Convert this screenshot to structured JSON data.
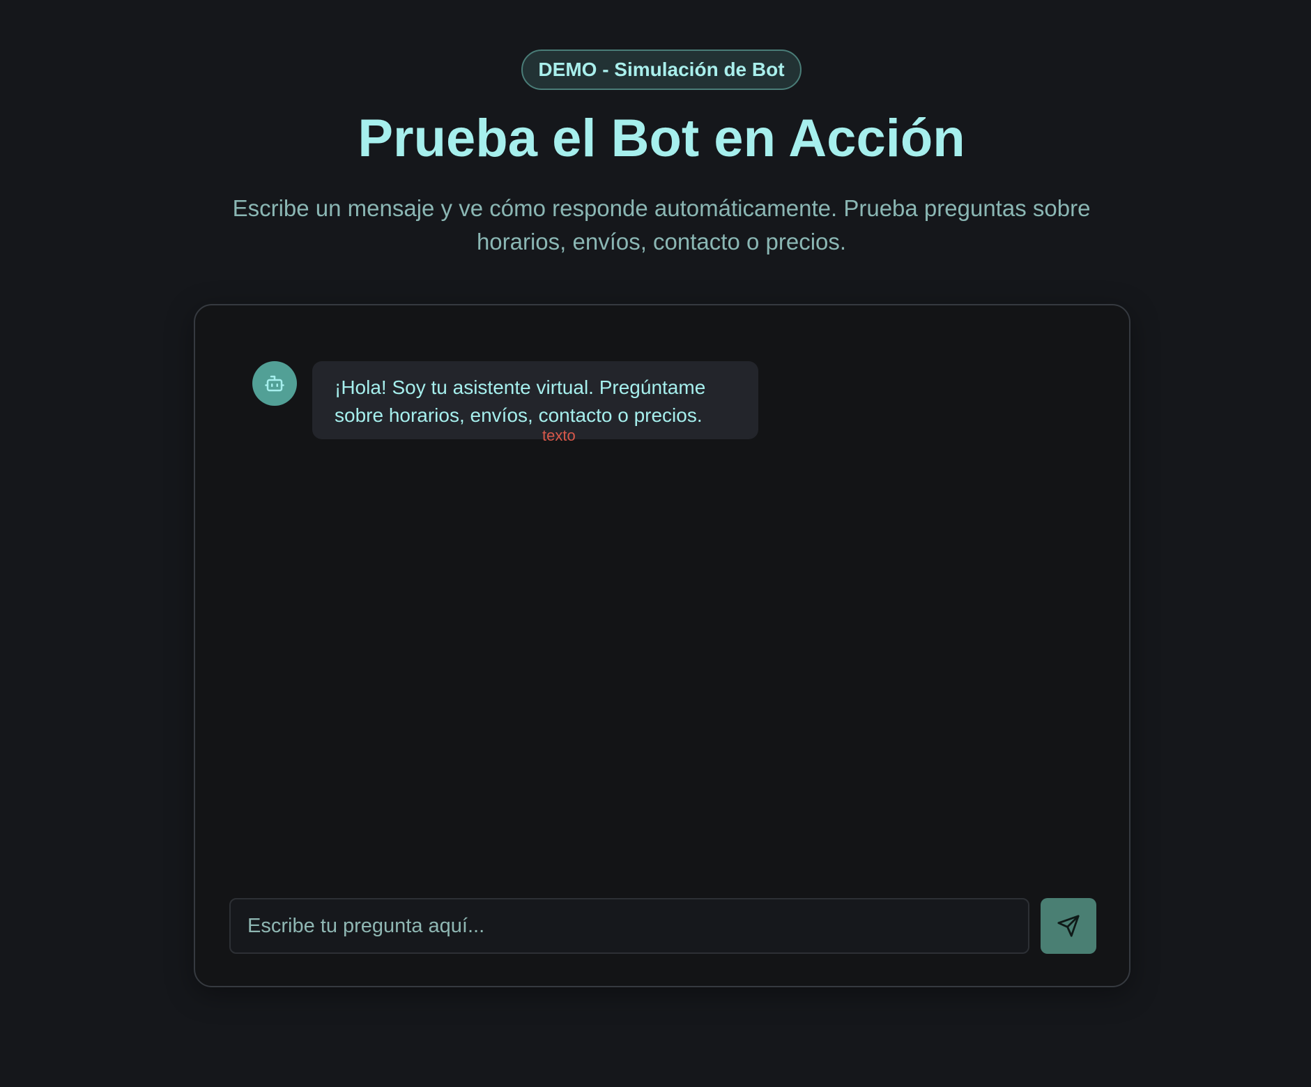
{
  "header": {
    "badge": "DEMO - Simulación de Bot",
    "title": "Prueba el Bot en Acción",
    "subtitle": "Escribe un mensaje y ve cómo responde automáticamente. Prueba preguntas sobre horarios, envíos, contacto o precios."
  },
  "chat": {
    "messages": [
      {
        "sender": "bot",
        "avatar_icon": "robot-icon",
        "text": "¡Hola! Soy tu asistente virtual. Pregúntame sobre horarios, envíos, contacto o precios.",
        "tag": "texto"
      }
    ],
    "input": {
      "placeholder": "Escribe tu pregunta aquí...",
      "value": ""
    },
    "send_icon": "send-icon"
  },
  "colors": {
    "background": "#15171b",
    "accent": "#a6efed",
    "avatar": "#52a096",
    "send_button": "#4a7f73",
    "tag": "#d8584a"
  }
}
